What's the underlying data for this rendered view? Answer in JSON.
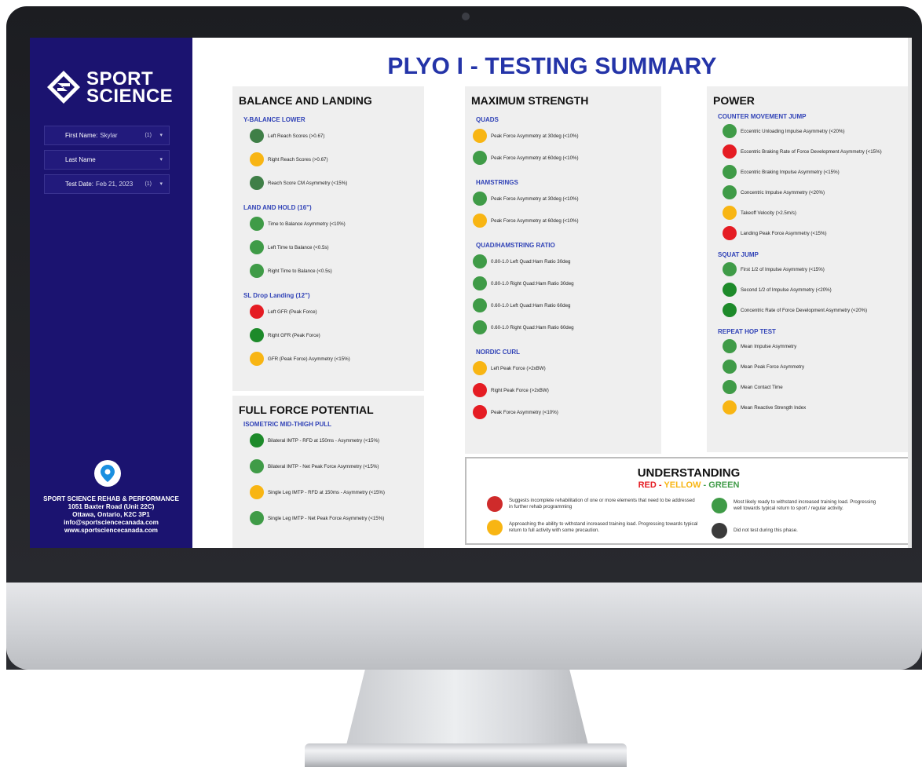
{
  "sidebar": {
    "logo_line1": "SPORT",
    "logo_line2": "SCIENCE",
    "filters": [
      {
        "label": "First Name:",
        "value": "Skylar",
        "count": "(1)"
      },
      {
        "label": "Last Name",
        "value": "",
        "count": ""
      },
      {
        "label": "Test Date:",
        "value": "Feb 21, 2023",
        "count": "(1)"
      }
    ],
    "contact": {
      "name": "SPORT SCIENCE REHAB & PERFORMANCE",
      "address1": "1051 Baxter Road (Unit 22C)",
      "address2": "Ottawa, Ontario, K2C 3P1",
      "email": "info@sportsciencecanada.com",
      "website": "www.sportsciencecanada.com"
    }
  },
  "title": "PLYO I - TESTING SUMMARY",
  "balance": {
    "heading": "BALANCE AND LANDING",
    "sections": [
      {
        "label": "Y-BALANCE LOWER",
        "items": [
          {
            "text": "Left Reach Scores (>0.67)",
            "color": "#3f7f47"
          },
          {
            "text": "Right Reach Scores (>0.67)",
            "color": "#f8b513"
          },
          {
            "text": "Reach Score CM Asymmetry (<15%)",
            "color": "#3f7f47"
          }
        ]
      },
      {
        "label": "LAND AND HOLD (16\")",
        "items": [
          {
            "text": "Time to Balance Asymmetry (<10%)",
            "color": "#3f9b47"
          },
          {
            "text": "Left Time to Balance (<0.5s)",
            "color": "#3f9b47"
          },
          {
            "text": "Right Time to Balance (<0.5s)",
            "color": "#3f9b47"
          }
        ]
      },
      {
        "label": "SL Drop Landing (12\")",
        "items": [
          {
            "text": "Left GFR (Peak Force)",
            "color": "#e51c23"
          },
          {
            "text": "Right GFR (Peak Force)",
            "color": "#1d8a2a"
          },
          {
            "text": "GFR (Peak Force) Asymmetry (<15%)",
            "color": "#f8b513"
          }
        ]
      }
    ]
  },
  "force": {
    "heading": "FULL FORCE POTENTIAL",
    "sections": [
      {
        "label": "ISOMETRIC MID-THIGH PULL",
        "items": [
          {
            "text": "Bilateral IMTP - RFD at 150ms - Asymmetry (<15%)",
            "color": "#1d8a2a"
          },
          {
            "text": "Bilateral IMTP - Net Peak Force Asymmetry (<15%)",
            "color": "#3f9b47"
          },
          {
            "text": "Single Leg IMTP - RFD at 150ms - Asymmetry (<15%)",
            "color": "#f8b513"
          },
          {
            "text": "Single Leg IMTP - Net Peak Force Asymmetry (<15%)",
            "color": "#3f9b47"
          }
        ]
      }
    ]
  },
  "strength": {
    "heading": "MAXIMUM STRENGTH",
    "sections": [
      {
        "label": "QUADS",
        "items": [
          {
            "text": "Peak Force Asymmetry at 30deg (<10%)",
            "color": "#f8b513"
          },
          {
            "text": "Peak Force Asymmetry at 60deg (<10%)",
            "color": "#3f9b47"
          }
        ]
      },
      {
        "label": "HAMSTRINGS",
        "items": [
          {
            "text": "Peak Force Asymmetry at 30deg (<10%)",
            "color": "#3f9b47"
          },
          {
            "text": "Peak Force Asymmetry at 60deg (<10%)",
            "color": "#f8b513"
          }
        ]
      },
      {
        "label": "QUAD/HAMSTRING RATIO",
        "items": [
          {
            "text": "0.80-1.0 Left Quad:Ham Ratio 30deg",
            "color": "#3f9b47"
          },
          {
            "text": "0.80-1.0 Right Quad:Ham Ratio 30deg",
            "color": "#3f9b47"
          },
          {
            "text": "0.60-1.0 Left Quad:Ham Ratio 60deg",
            "color": "#3f9b47"
          },
          {
            "text": "0.60-1.0 Right Quad:Ham Ratio 60deg",
            "color": "#3f9b47"
          }
        ]
      },
      {
        "label": "NORDIC CURL",
        "items": [
          {
            "text": "Left Peak Force (>2xBW)",
            "color": "#f8b513"
          },
          {
            "text": "Right Peak Force (>2xBW)",
            "color": "#e51c23"
          },
          {
            "text": "Peak Force Asymmetry (<10%)",
            "color": "#e51c23"
          }
        ]
      }
    ]
  },
  "power": {
    "heading": "POWER",
    "sections": [
      {
        "label": "COUNTER MOVEMENT JUMP",
        "items": [
          {
            "text": "Eccentric Unloading Impulse Asymmetry (<20%)",
            "color": "#3f9b47"
          },
          {
            "text": "Eccentric Braking Rate of Force Development Asymmetry (<15%)",
            "color": "#e51c23"
          },
          {
            "text": "Eccentric Braking Impulse Asymmetry (<15%)",
            "color": "#3f9b47"
          },
          {
            "text": "Concentric Impulse Asymmetry (<20%)",
            "color": "#3f9b47"
          },
          {
            "text": "Takeoff Velocity (>2.5m/s)",
            "color": "#f8b513"
          },
          {
            "text": "Landing Peak Force Asymmetry (<15%)",
            "color": "#e51c23"
          }
        ]
      },
      {
        "label": "SQUAT JUMP",
        "items": [
          {
            "text": "First 1/2 of Impulse Asymmetry (<15%)",
            "color": "#3f9b47"
          },
          {
            "text": "Second 1/2 of Impulse Asymmetry (<20%)",
            "color": "#1d8a2a"
          },
          {
            "text": "Concentric Rate of Force Development Asymmetry (<20%)",
            "color": "#1d8a2a"
          }
        ]
      },
      {
        "label": "REPEAT HOP TEST",
        "items": [
          {
            "text": "Mean Impulse Asymmetry",
            "color": "#3f9b47"
          },
          {
            "text": "Mean Peak Force Asymmetry",
            "color": "#3f9b47"
          },
          {
            "text": "Mean Contact Time",
            "color": "#3f9b47"
          },
          {
            "text": "Mean Reactive Strength Index",
            "color": "#f8b513"
          }
        ]
      }
    ]
  },
  "legend": {
    "heading": "UNDERSTANDING",
    "red": "RED",
    "yellow": "YELLOW",
    "green": "GREEN",
    "sep": " - ",
    "red_text": "Suggests incomplete rehabilitation of one or more elements that need to be addressed in further rehab programming",
    "yellow_text": "Approaching the ability to withstand increased training load. Progressing towards typical return to full activity with some precaution.",
    "green_text": "Most likely ready to withstand increased training load. Progressing well towards typical return to sport / regular activity.",
    "gray_text": "Did not test during this phase.",
    "colors": {
      "red": "#cf2b2b",
      "yellow": "#f8b513",
      "green": "#3f9b47",
      "gray": "#3b3b3b"
    }
  }
}
